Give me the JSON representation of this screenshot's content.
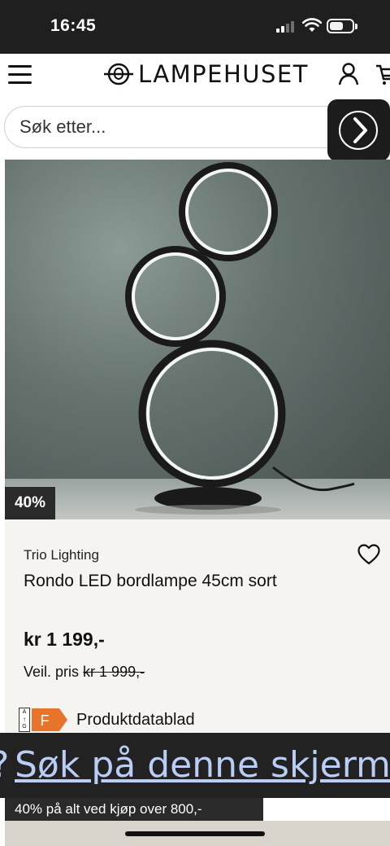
{
  "status_bar": {
    "time": "16:45"
  },
  "header": {
    "brand": "LAMPEHUSET"
  },
  "search": {
    "placeholder": "Søk etter..."
  },
  "product": {
    "discount_badge": "40%",
    "brand": "Trio Lighting",
    "title": "Rondo LED bordlampe 45cm sort",
    "price": "kr 1 199,-",
    "regular_price_label": "Veil. pris",
    "regular_price": "kr 1 999,-",
    "energy_scale": "A\nG",
    "energy_class": "F",
    "energy_class_color": "#e8742b",
    "datasheet_label": "Produktdatablad"
  },
  "lens_overlay": {
    "text": "Søk på denne skjermen"
  },
  "promo_banner": {
    "text": "40% på alt ved kjøp over 800,-"
  },
  "icons": [
    "menu-icon",
    "lampehuset-logo-icon",
    "user-icon",
    "cart-icon",
    "chevron-right-icon",
    "heart-icon"
  ]
}
